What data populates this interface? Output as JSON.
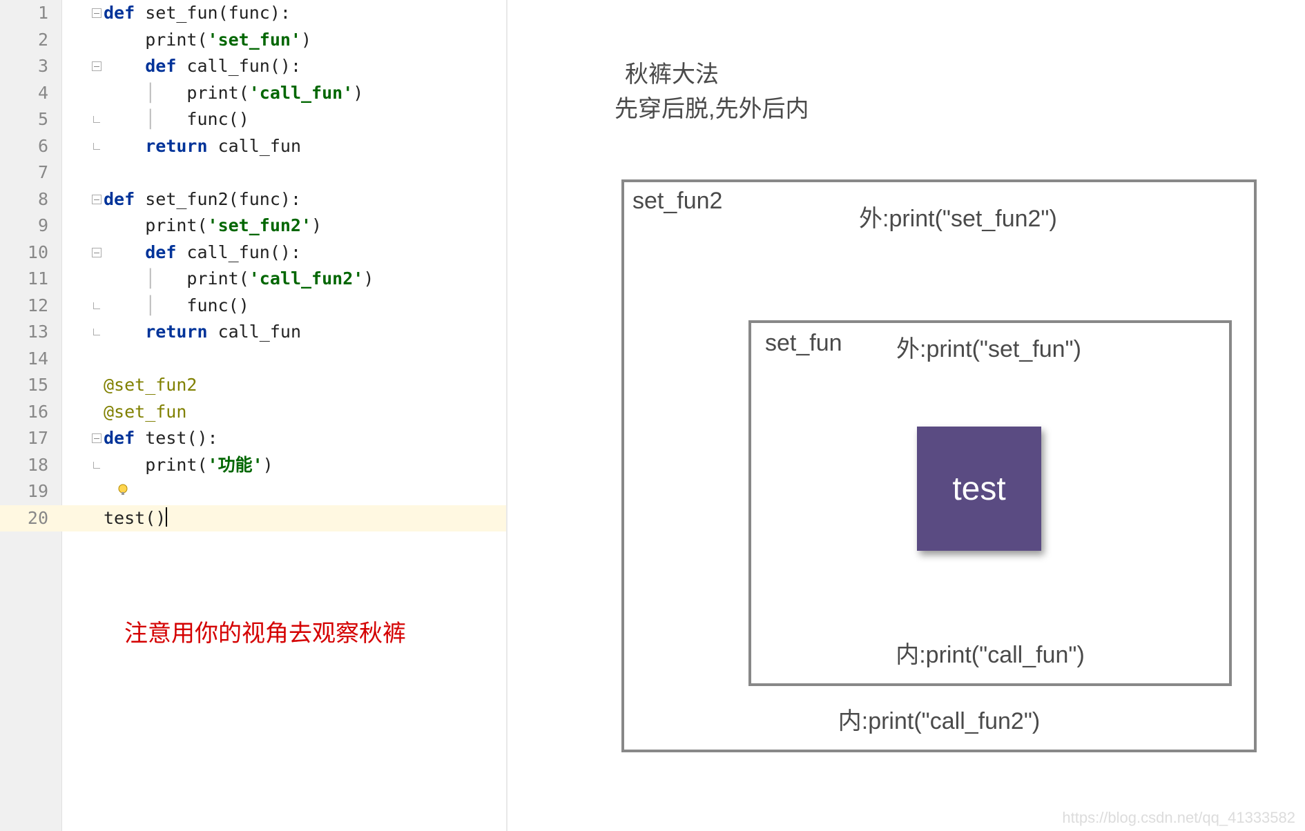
{
  "editor": {
    "lines": [
      {
        "n": "1",
        "html": "<span class='kw'>def</span> <span class='fn'>set_fun</span>(func):"
      },
      {
        "n": "2",
        "html": "    print(<span class='str'>'set_fun'</span>)"
      },
      {
        "n": "3",
        "html": "    <span class='kw'>def</span> <span class='fn'>call_fun</span>():"
      },
      {
        "n": "4",
        "html": "    <span class='bar'>│</span>   print(<span class='str'>'call_fun'</span>)"
      },
      {
        "n": "5",
        "html": "    <span class='bar'>│</span>   func()"
      },
      {
        "n": "6",
        "html": "    <span class='kw'>return</span> call_fun"
      },
      {
        "n": "7",
        "html": ""
      },
      {
        "n": "8",
        "html": "<span class='kw'>def</span> <span class='fn'>set_fun2</span>(func):"
      },
      {
        "n": "9",
        "html": "    print(<span class='str'>'set_fun2'</span>)"
      },
      {
        "n": "10",
        "html": "    <span class='kw'>def</span> <span class='fn'>call_fun</span>():"
      },
      {
        "n": "11",
        "html": "    <span class='bar'>│</span>   print(<span class='str'>'call_fun2'</span>)"
      },
      {
        "n": "12",
        "html": "    <span class='bar'>│</span>   func()"
      },
      {
        "n": "13",
        "html": "    <span class='kw'>return</span> call_fun"
      },
      {
        "n": "14",
        "html": ""
      },
      {
        "n": "15",
        "html": "<span class='dec'>@set_fun2</span>"
      },
      {
        "n": "16",
        "html": "<span class='dec'>@set_fun</span>"
      },
      {
        "n": "17",
        "html": "<span class='kw'>def</span> <span class='fn'>test</span>():"
      },
      {
        "n": "18",
        "html": "    print(<span class='str'>'功能'</span>)"
      },
      {
        "n": "19",
        "html": ""
      },
      {
        "n": "20",
        "html": "test()"
      }
    ],
    "current_line_index": 19
  },
  "annotations": {
    "red_note": "注意用你的视角去观察秋裤",
    "qk_title": "秋裤大法",
    "qk_sub": "先穿后脱,先外后内",
    "outer_label": "set_fun2",
    "outer_right": "外:print(\"set_fun2\")",
    "inner_label": "set_fun",
    "inner_right": "外:print(\"set_fun\")",
    "test_label": "test",
    "inner_bottom": "内:print(\"call_fun\")",
    "outer_bottom": "内:print(\"call_fun2\")"
  },
  "watermark": "https://blog.csdn.net/qq_41333582"
}
